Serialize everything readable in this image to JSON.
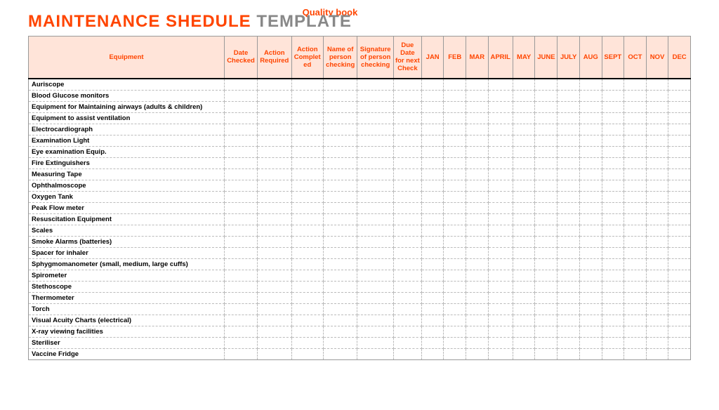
{
  "brand": "Quality book",
  "title": {
    "part1": "MAINTENANCE SHEDULE",
    "part2": "TEMPLATE"
  },
  "headers": {
    "equipment": "Equipment",
    "date_checked": "Date Checked",
    "action_required": "Action Required",
    "action_completed": "Action Complet ed",
    "name_checking": "Name of person checking",
    "signature_checking": "Signature of person checking",
    "due_date": "Due Date for next Check",
    "months": [
      "JAN",
      "FEB",
      "MAR",
      "APRIL",
      "MAY",
      "JUNE",
      "JULY",
      "AUG",
      "SEPT",
      "OCT",
      "NOV",
      "DEC"
    ]
  },
  "equipment": [
    "Auriscope",
    "Blood Glucose monitors",
    "Equipment for Maintaining airways (adults & children)",
    "Equipment to assist ventilation",
    "Electrocardiograph",
    "Examination Light",
    "Eye examination Equip.",
    "Fire Extinguishers",
    "Measuring Tape",
    "Ophthalmoscope",
    "Oxygen Tank",
    "Peak Flow meter",
    "Resuscitation Equipment",
    "Scales",
    "Smoke Alarms (batteries)",
    "Spacer for inhaler",
    "Sphygmomanometer (small, medium, large cuffs)",
    "Spirometer",
    "Stethoscope",
    "Thermometer",
    "Torch",
    "Visual Acuity Charts (electrical)",
    "X-ray viewing facilities",
    "Steriliser",
    "Vaccine Fridge"
  ]
}
